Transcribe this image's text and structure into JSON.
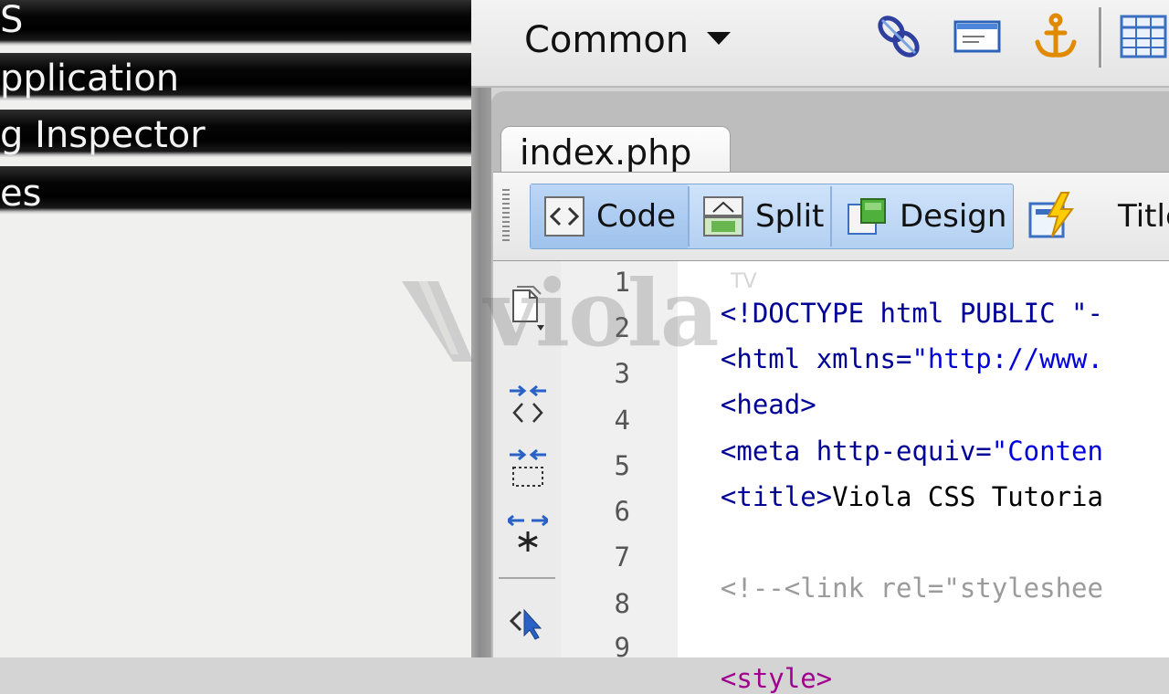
{
  "left_panel": {
    "headers": [
      {
        "label": "S"
      },
      {
        "label": "pplication"
      },
      {
        "label": "g Inspector"
      },
      {
        "label": "es"
      }
    ]
  },
  "insert_bar": {
    "category": "Common",
    "icons": [
      "hyperlink-icon",
      "email-link-icon",
      "named-anchor-icon",
      "table-icon"
    ]
  },
  "document": {
    "tab_label": "index.php",
    "view_buttons": [
      {
        "label": "Code",
        "icon": "code-view-icon"
      },
      {
        "label": "Split",
        "icon": "split-view-icon"
      },
      {
        "label": "Design",
        "icon": "design-view-icon"
      }
    ],
    "live_icon": "live-view-icon",
    "title_label": "Title"
  },
  "code_toolbar_icons": [
    "open-documents-icon",
    "collapse-full-tag-icon",
    "collapse-selection-icon",
    "expand-all-icon",
    "select-parent-tag-icon"
  ],
  "code": {
    "line_numbers": [
      "1",
      "2",
      "3",
      "4",
      "5",
      "6",
      "7",
      "8",
      "9"
    ],
    "lines": [
      {
        "tag": "<!DOCTYPE html PUBLIC \"-",
        "extra": ""
      },
      {
        "tag": "<html ",
        "attr": "xmlns=",
        "str": "\"http://www."
      },
      {
        "tag": "<head>"
      },
      {
        "tag": "<meta ",
        "attr": "http-equiv=",
        "str": "\"Conten"
      },
      {
        "tag": "<title>",
        "text": "Viola CSS Tutoria"
      },
      {},
      {
        "comment": "<!--<link rel=\"styleshee"
      },
      {},
      {
        "style": "<style>"
      }
    ]
  },
  "watermark": {
    "text": "viola",
    "suffix": "TV"
  }
}
